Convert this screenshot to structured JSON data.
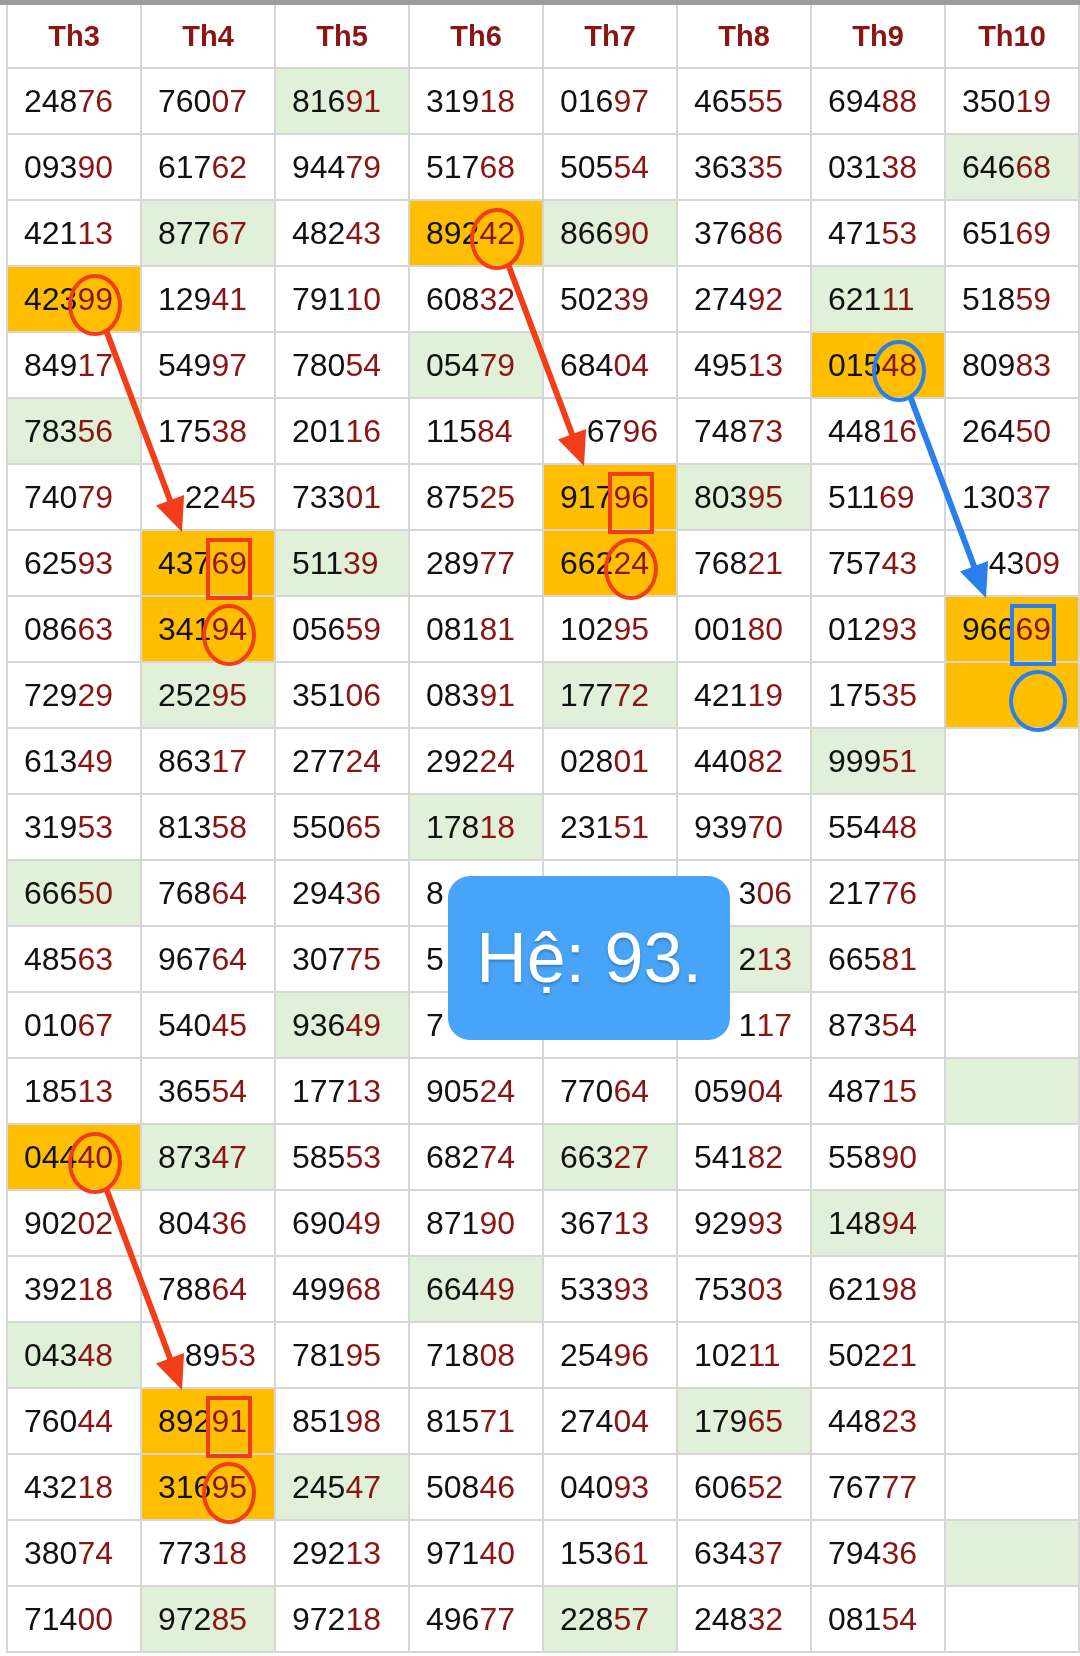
{
  "columns": [
    "Th3",
    "Th4",
    "Th5",
    "Th6",
    "Th7",
    "Th8",
    "Th9",
    "Th10"
  ],
  "rows": [
    {
      "cells": [
        {
          "text": "24876"
        },
        {
          "text": "76007"
        },
        {
          "text": "81691",
          "color": "#e0f0d9"
        },
        {
          "text": "31918"
        },
        {
          "text": "01697"
        },
        {
          "text": "46555"
        },
        {
          "text": "69488"
        },
        {
          "text": "35019"
        }
      ]
    },
    {
      "cells": [
        {
          "text": "09390"
        },
        {
          "text": "61762"
        },
        {
          "text": "94479"
        },
        {
          "text": "51768"
        },
        {
          "text": "50554"
        },
        {
          "text": "36335"
        },
        {
          "text": "03138"
        },
        {
          "text": "64668",
          "color": "#e0f0d9"
        }
      ]
    },
    {
      "cells": [
        {
          "text": "42113"
        },
        {
          "text": "87767",
          "color": "#e0f0d9"
        },
        {
          "text": "48243"
        },
        {
          "text": "89242",
          "color": "#ffbf00",
          "mark": {
            "kind": "circle",
            "color": "#f23d1a"
          },
          "arrow": {
            "color": "#f23d1a"
          }
        },
        {
          "text": "86690",
          "color": "#e0f0d9"
        },
        {
          "text": "37686"
        },
        {
          "text": "47153"
        },
        {
          "text": "65169"
        }
      ]
    },
    {
      "cells": [
        {
          "text": "42399",
          "color": "#ffbf00",
          "mark": {
            "kind": "circle",
            "color": "#f23d1a"
          },
          "arrow": {
            "color": "#f23d1a"
          }
        },
        {
          "text": "12941"
        },
        {
          "text": "79110"
        },
        {
          "text": "60832"
        },
        {
          "text": "50239"
        },
        {
          "text": "27492"
        },
        {
          "text": "62111",
          "color": "#e0f0d9"
        },
        {
          "text": "51859"
        }
      ]
    },
    {
      "cells": [
        {
          "text": "84917"
        },
        {
          "text": "54997"
        },
        {
          "text": "78054"
        },
        {
          "text": "05479",
          "color": "#e0f0d9"
        },
        {
          "text": "68404"
        },
        {
          "text": "49513"
        },
        {
          "text": "01548",
          "color": "#ffbf00",
          "mark": {
            "kind": "circle",
            "color": "#2a7fec"
          },
          "arrow": {
            "color": "#2a7fec"
          }
        },
        {
          "text": "80983"
        }
      ]
    },
    {
      "cells": [
        {
          "text": "78356",
          "color": "#e0f0d9"
        },
        {
          "text": "17538"
        },
        {
          "text": "20116"
        },
        {
          "text": "11584"
        },
        {
          "text": "6796",
          "kind": "cut_start"
        },
        {
          "text": "74873"
        },
        {
          "text": "44816"
        },
        {
          "text": "26450"
        }
      ]
    },
    {
      "cells": [
        {
          "text": "74079"
        },
        {
          "text": "2245",
          "kind": "cut_start"
        },
        {
          "text": "73301"
        },
        {
          "text": "87525"
        },
        {
          "text": "91796",
          "color": "#ffbf00",
          "mark": {
            "kind": "box",
            "color": "#f23d1a"
          },
          "arrow_target": true
        },
        {
          "text": "80395",
          "color": "#e0f0d9"
        },
        {
          "text": "51169"
        },
        {
          "text": "13037"
        }
      ]
    },
    {
      "cells": [
        {
          "text": "62593"
        },
        {
          "text": "43769",
          "color": "#ffbf00",
          "mark": {
            "kind": "box",
            "color": "#f23d1a"
          },
          "arrow_target": true
        },
        {
          "text": "51139",
          "color": "#e0f0d9"
        },
        {
          "text": "28977"
        },
        {
          "text": "66224",
          "color": "#ffbf00",
          "mark": {
            "kind": "circle",
            "color": "#f23d1a"
          }
        },
        {
          "text": "76821"
        },
        {
          "text": "75743"
        },
        {
          "text": "4309",
          "kind": "cut_start"
        }
      ]
    },
    {
      "cells": [
        {
          "text": "08663"
        },
        {
          "text": "34194",
          "color": "#ffbf00",
          "mark": {
            "kind": "circle",
            "color": "#f23d1a"
          }
        },
        {
          "text": "05659"
        },
        {
          "text": "08181"
        },
        {
          "text": "10295"
        },
        {
          "text": "00180"
        },
        {
          "text": "01293"
        },
        {
          "text": "96669",
          "color": "#ffbf00",
          "mark": {
            "kind": "box",
            "color": "#2a7fec"
          },
          "arrow_target": true
        }
      ]
    },
    {
      "cells": [
        {
          "text": "72929"
        },
        {
          "text": "25295",
          "color": "#e0f0d9"
        },
        {
          "text": "35106"
        },
        {
          "text": "08391"
        },
        {
          "text": "17772",
          "color": "#e0f0d9"
        },
        {
          "text": "42119"
        },
        {
          "text": "17535"
        },
        {
          "color": "#ffbf00",
          "mark": {
            "kind": "circle",
            "color": "#2a7fec"
          }
        }
      ]
    },
    {
      "cells": [
        {
          "text": "61349"
        },
        {
          "text": "86317"
        },
        {
          "text": "27724"
        },
        {
          "text": "29224"
        },
        {
          "text": "02801"
        },
        {
          "text": "44082"
        },
        {
          "text": "99951",
          "color": "#e0f0d9"
        },
        {}
      ]
    },
    {
      "cells": [
        {
          "text": "31953"
        },
        {
          "text": "81358"
        },
        {
          "text": "55065"
        },
        {
          "text": "17818",
          "color": "#e0f0d9"
        },
        {
          "text": "23151"
        },
        {
          "text": "93970"
        },
        {
          "text": "55448"
        },
        {}
      ]
    },
    {
      "cells": [
        {
          "text": "66650",
          "color": "#e0f0d9"
        },
        {
          "text": "76864"
        },
        {
          "text": "29436"
        },
        {
          "text": "8",
          "kind": "cut_end"
        },
        {},
        {
          "text": "306",
          "kind": "cut_start"
        },
        {
          "text": "21776"
        },
        {}
      ]
    },
    {
      "cells": [
        {
          "text": "48563"
        },
        {
          "text": "96764"
        },
        {
          "text": "30775"
        },
        {
          "text": "5",
          "kind": "cut_end"
        },
        {},
        {
          "text": "213",
          "kind": "cut_start",
          "color": "#e0f0d9"
        },
        {
          "text": "66581"
        },
        {}
      ]
    },
    {
      "cells": [
        {
          "text": "01067"
        },
        {
          "text": "54045"
        },
        {
          "text": "93649",
          "color": "#e0f0d9"
        },
        {
          "text": "7",
          "kind": "cut_end"
        },
        {},
        {
          "text": "117",
          "kind": "cut_start"
        },
        {
          "text": "87354"
        },
        {}
      ]
    },
    {
      "cells": [
        {
          "text": "18513"
        },
        {
          "text": "36554"
        },
        {
          "text": "17713"
        },
        {
          "text": "90524"
        },
        {
          "text": "77064"
        },
        {
          "text": "05904"
        },
        {
          "text": "48715"
        },
        {
          "color": "#e0f0d9"
        }
      ]
    },
    {
      "cells": [
        {
          "text": "04440",
          "color": "#ffbf00",
          "mark": {
            "kind": "circle",
            "color": "#f23d1a"
          },
          "arrow": {
            "color": "#f23d1a"
          }
        },
        {
          "text": "87347",
          "color": "#e0f0d9"
        },
        {
          "text": "58553"
        },
        {
          "text": "68274"
        },
        {
          "text": "66327",
          "color": "#e0f0d9"
        },
        {
          "text": "54182"
        },
        {
          "text": "55890"
        },
        {}
      ]
    },
    {
      "cells": [
        {
          "text": "90202"
        },
        {
          "text": "80436"
        },
        {
          "text": "69049"
        },
        {
          "text": "87190"
        },
        {
          "text": "36713"
        },
        {
          "text": "92993"
        },
        {
          "text": "14894",
          "color": "#e0f0d9"
        },
        {}
      ]
    },
    {
      "cells": [
        {
          "text": "39218"
        },
        {
          "text": "78864"
        },
        {
          "text": "49968"
        },
        {
          "text": "66449",
          "color": "#e0f0d9"
        },
        {
          "text": "53393"
        },
        {
          "text": "75303"
        },
        {
          "text": "62198"
        },
        {}
      ]
    },
    {
      "cells": [
        {
          "text": "04348",
          "color": "#e0f0d9"
        },
        {
          "text": "8953",
          "kind": "cut_start"
        },
        {
          "text": "78195"
        },
        {
          "text": "71808"
        },
        {
          "text": "25496"
        },
        {
          "text": "10211"
        },
        {
          "text": "50221"
        },
        {}
      ]
    },
    {
      "cells": [
        {
          "text": "76044"
        },
        {
          "text": "89291",
          "color": "#ffbf00",
          "mark": {
            "kind": "box",
            "color": "#f23d1a"
          },
          "arrow_target": true
        },
        {
          "text": "85198"
        },
        {
          "text": "81571"
        },
        {
          "text": "27404"
        },
        {
          "text": "17965",
          "color": "#e0f0d9"
        },
        {
          "text": "44823"
        },
        {}
      ]
    },
    {
      "cells": [
        {
          "text": "43218"
        },
        {
          "text": "31695",
          "color": "#ffbf00",
          "mark": {
            "kind": "circle",
            "color": "#f23d1a"
          }
        },
        {
          "text": "24547",
          "color": "#e0f0d9"
        },
        {
          "text": "50846"
        },
        {
          "text": "04093"
        },
        {
          "text": "60652"
        },
        {
          "text": "76777"
        },
        {}
      ]
    },
    {
      "cells": [
        {
          "text": "38074"
        },
        {
          "text": "77318"
        },
        {
          "text": "29213"
        },
        {
          "text": "97140"
        },
        {
          "text": "15361"
        },
        {
          "text": "63437"
        },
        {
          "text": "79436"
        },
        {
          "color": "#e0f0d9"
        }
      ]
    },
    {
      "cells": [
        {
          "text": "71400"
        },
        {
          "text": "97285",
          "color": "#e0f0d9"
        },
        {
          "text": "97218"
        },
        {
          "text": "49677"
        },
        {
          "text": "22857",
          "color": "#e0f0d9"
        },
        {
          "text": "24832"
        },
        {
          "text": "08154"
        },
        {}
      ]
    }
  ],
  "popup": {
    "text": "Hệ: 93."
  }
}
